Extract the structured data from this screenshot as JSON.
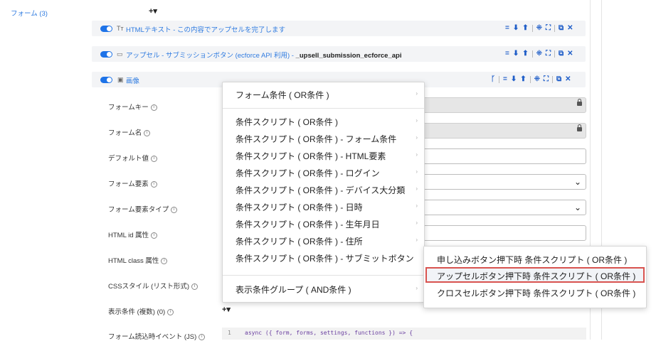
{
  "sidebar": {
    "form_label": "フォーム (3)"
  },
  "header": {
    "add_label": "+▾"
  },
  "rows": [
    {
      "type_icon": "Tт",
      "title": "HTMLテキスト - この内容でアップセルを完了します",
      "suffix": ""
    },
    {
      "type_icon": "▭",
      "title": "アップセル - サブミッションボタン (ecforce API 利用) - ",
      "suffix": "_upsell_submission_ecforce_api"
    },
    {
      "type_icon": "▣",
      "title": "画像",
      "suffix": ""
    }
  ],
  "row_actions": {
    "branch": "ᚴ",
    "eq": "=",
    "down": "⬇",
    "up": "⬆",
    "drag": "⁜",
    "expand": "⛶",
    "copy": "⧉",
    "close": "✕"
  },
  "fields": [
    {
      "label": "フォームキー"
    },
    {
      "label": "フォーム名"
    },
    {
      "label": "デフォルト値"
    },
    {
      "label": "フォーム要素"
    },
    {
      "label": "フォーム要素タイプ"
    },
    {
      "label": "HTML id 属性"
    },
    {
      "label": "HTML class 属性"
    },
    {
      "label": "CSSスタイル (リスト形式)"
    },
    {
      "label": "表示条件 (複数) (0)"
    },
    {
      "label": "フォーム読込時イベント (JS)"
    }
  ],
  "info_glyph": "i",
  "add_condition_label": "+▾",
  "menu": {
    "items": [
      "フォーム条件 ( OR条件 )",
      "条件スクリプト ( OR条件 )",
      "条件スクリプト ( OR条件 ) - フォーム条件",
      "条件スクリプト ( OR条件 ) - HTML要素",
      "条件スクリプト ( OR条件 ) - ログイン",
      "条件スクリプト ( OR条件 ) - デバイス大分類",
      "条件スクリプト ( OR条件 ) - 日時",
      "条件スクリプト ( OR条件 ) - 生年月日",
      "条件スクリプト ( OR条件 ) - 住所",
      "条件スクリプト ( OR条件 ) - サブミットボタン",
      "表示条件グループ ( AND条件 )"
    ],
    "arrow": "›"
  },
  "submenu": {
    "items": [
      "申し込みボタン押下時 条件スクリプト ( OR条件 )",
      "アップセルボタン押下時 条件スクリプト ( OR条件 )",
      "クロスセルボタン押下時 条件スクリプト ( OR条件 )"
    ]
  },
  "code": {
    "line_number": "1",
    "text": "async ({ form, forms, settings, functions }) => {"
  },
  "colors": {
    "accent": "#1e73e8",
    "highlight_border": "#d9534f"
  }
}
